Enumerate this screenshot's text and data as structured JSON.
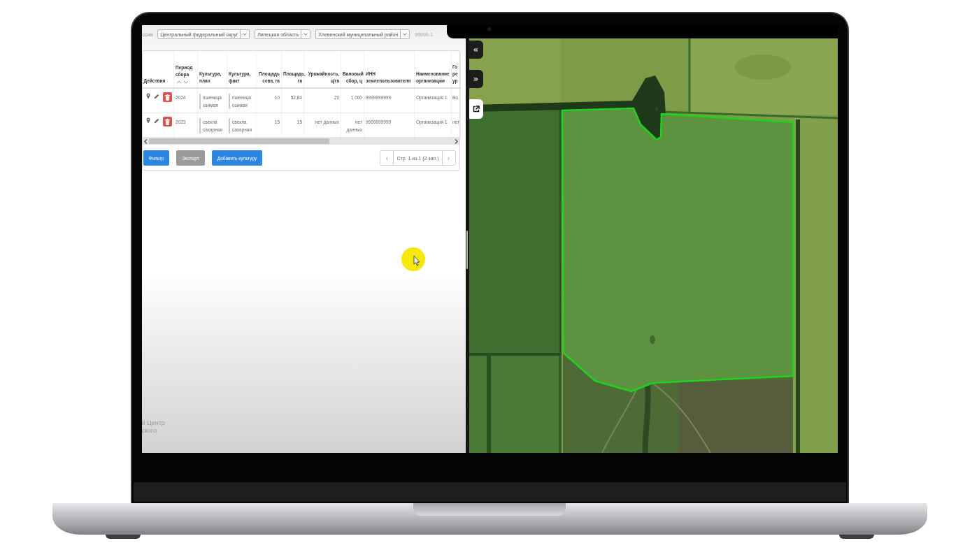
{
  "top_bar": {
    "country": "ссия",
    "filters": [
      {
        "value": "Центральный федеральный округ"
      },
      {
        "value": "Липецкая область"
      },
      {
        "value": "Хлевенский муниципальный район"
      }
    ],
    "code": "99999-1"
  },
  "table": {
    "columns": [
      {
        "label": "Действия",
        "kind": "actions",
        "sortable": false
      },
      {
        "label": "Период сбора",
        "kind": "text",
        "sortable": true
      },
      {
        "label": "Культура, план",
        "kind": "crop",
        "sortable": false
      },
      {
        "label": "Культура, факт",
        "kind": "crop",
        "sortable": false
      },
      {
        "label": "Площадь сева, га",
        "kind": "number",
        "sortable": false
      },
      {
        "label": "Площадь, га",
        "kind": "number",
        "sortable": false
      },
      {
        "label": "Урожайность, ц/га",
        "kind": "number",
        "sortable": false
      },
      {
        "label": "Валовый сбор, ц",
        "kind": "number",
        "sortable": false
      },
      {
        "label": "ИНН землепользователя",
        "kind": "text",
        "sortable": false
      },
      {
        "label": "Наименование организации",
        "kind": "text",
        "sortable": false
      },
      {
        "label": "Го ре ур",
        "kind": "text",
        "sortable": false
      }
    ],
    "rows": [
      {
        "cells": [
          "",
          "2024",
          "пшеница озимая",
          "пшеница озимая",
          "10",
          "52,84",
          "20",
          "1 000",
          "9999999999",
          "Организация 1",
          "Во"
        ]
      },
      {
        "cells": [
          "",
          "2023",
          "свекла сахарная",
          "свекла сахарная",
          "15",
          "15",
          "нет данных",
          "нет данных",
          "9999999999",
          "Организация 1",
          "нет"
        ]
      }
    ]
  },
  "buttons": [
    {
      "label": "Фильтр",
      "kind": "primary"
    },
    {
      "label": "Экспорт",
      "kind": "secondary"
    },
    {
      "label": "Добавить культуру",
      "kind": "primary"
    }
  ],
  "pagination": {
    "previous": "‹",
    "label": "Стр. 1 из 1 (2 зап.)",
    "next": "›"
  },
  "footer": [
    "й Центр",
    "ского"
  ],
  "map": {
    "controls": [
      {
        "label": "«"
      },
      {
        "label": "»"
      }
    ]
  }
}
